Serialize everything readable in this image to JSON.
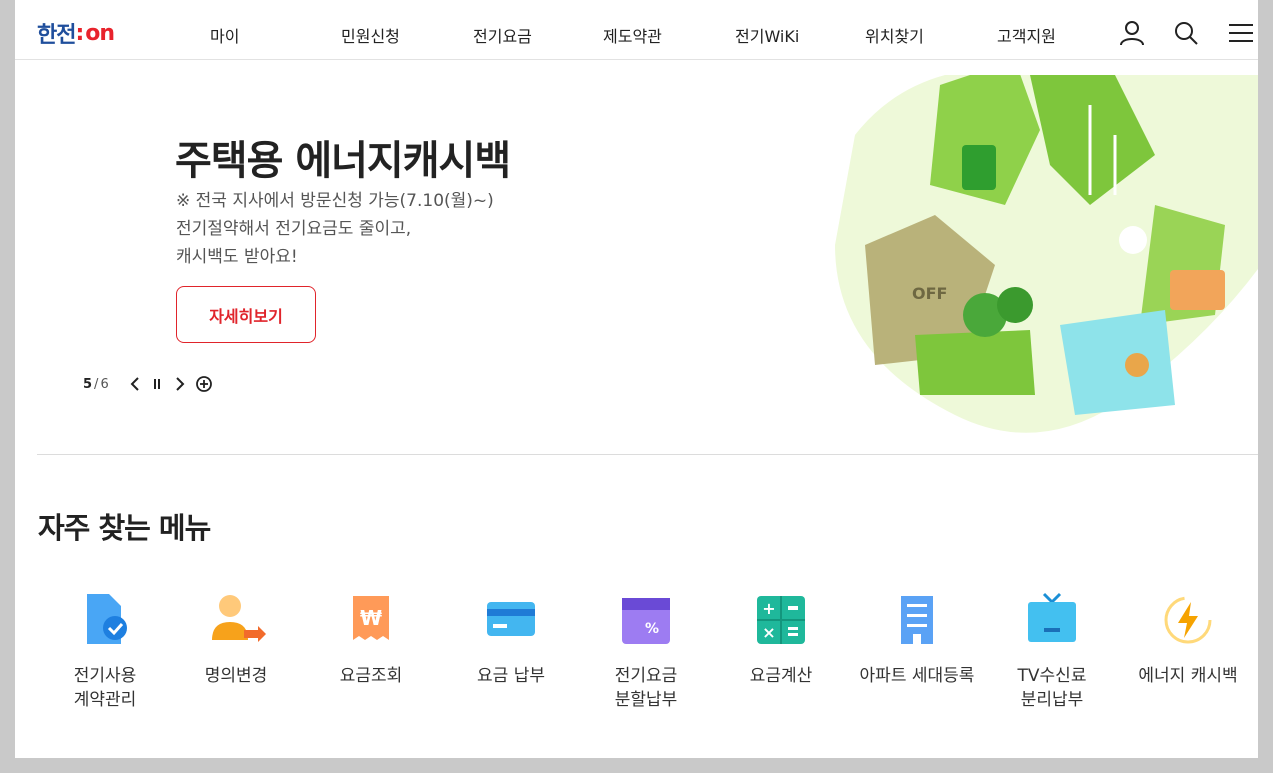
{
  "header": {
    "logo_text": "한전",
    "logo_on": "on",
    "nav": [
      "마이",
      "민원신청",
      "전기요금",
      "제도약관",
      "전기WiKi",
      "위치찾기",
      "고객지원"
    ],
    "icons": [
      "user-icon",
      "search-icon",
      "menu-icon"
    ]
  },
  "hero": {
    "title": "주택용 에너지캐시백",
    "line1": "※ 전국 지사에서 방문신청 가능(7.10(월)~)",
    "line2": "전기절약해서 전기요금도 줄이고,",
    "line3": "캐시백도 받아요!",
    "cta": "자세히보기",
    "pager_current": "5",
    "pager_sep": "/",
    "pager_total": "6",
    "illustration_text": "OFF"
  },
  "quick": {
    "title": "자주 찾는 메뉴",
    "items": [
      {
        "label": "전기사용\n계약관리",
        "icon": "document-check-icon"
      },
      {
        "label": "명의변경",
        "icon": "user-transfer-icon"
      },
      {
        "label": "요금조회",
        "icon": "receipt-icon"
      },
      {
        "label": "요금 납부",
        "icon": "card-icon"
      },
      {
        "label": "전기요금\n분할납부",
        "icon": "calendar-percent-icon"
      },
      {
        "label": "요금계산",
        "icon": "calculator-icon"
      },
      {
        "label": "아파트 세대등록",
        "icon": "apartment-icon"
      },
      {
        "label": "TV수신료\n분리납부",
        "icon": "tv-icon"
      },
      {
        "label": "에너지 캐시백",
        "icon": "energy-bolt-icon"
      }
    ]
  },
  "colors": {
    "brand_blue": "#1f4e9c",
    "brand_red": "#e0242b",
    "eco_green": "#8bd14a"
  }
}
